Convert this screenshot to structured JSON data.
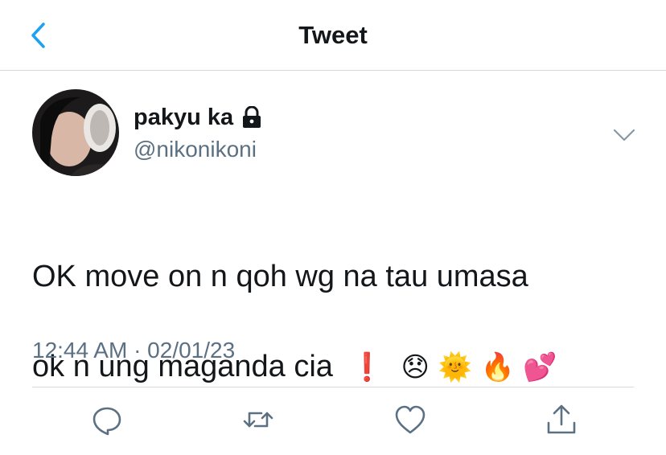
{
  "header": {
    "title": "Tweet",
    "back_icon": "chevron-left-icon",
    "accent_color": "#1da1f2"
  },
  "tweet": {
    "author": {
      "display_name": "pakyu ka",
      "handle": "@nikonikoni",
      "protected_icon": "lock-icon"
    },
    "text_line1": "OK move on n qoh wg na tau umasa",
    "text_line2": "ok n ung maganda cia",
    "emojis": [
      "❗",
      "😞",
      "🌞",
      "🔥",
      "💕"
    ],
    "timestamp": "12:44 AM · 02/01/23"
  },
  "actions": {
    "icons": [
      "reply-icon",
      "retweet-icon",
      "like-icon",
      "share-icon"
    ]
  }
}
